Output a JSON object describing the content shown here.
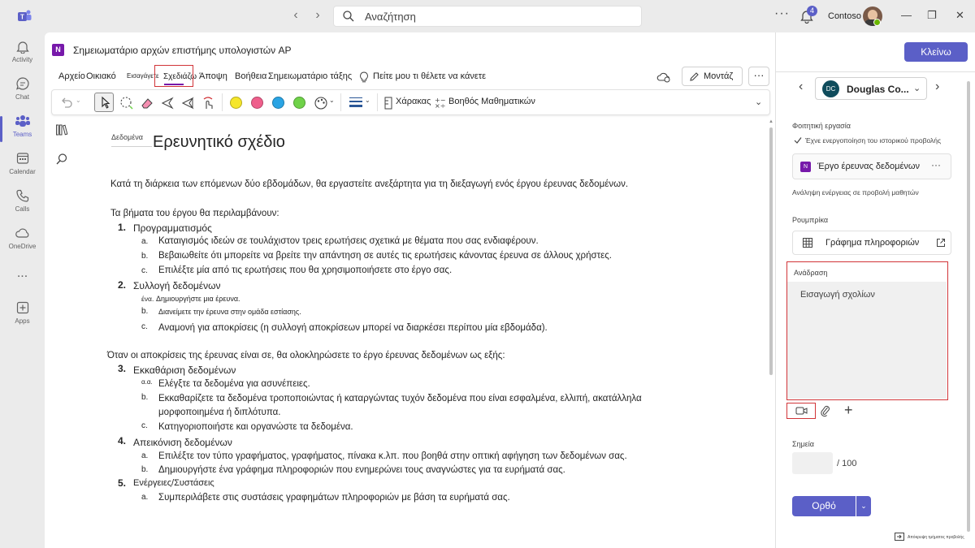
{
  "topbar": {
    "search_placeholder": "Αναζήτηση",
    "notification_count": "4",
    "org_name": "Contoso"
  },
  "rail": {
    "items": [
      {
        "label": "Activity",
        "icon": "bell-icon"
      },
      {
        "label": "Chat",
        "icon": "chat-icon"
      },
      {
        "label": "Teams",
        "icon": "teams-icon"
      },
      {
        "label": "Calendar",
        "icon": "calendar-icon"
      },
      {
        "label": "Calls",
        "icon": "phone-icon"
      },
      {
        "label": "OneDrive",
        "icon": "cloud-icon"
      },
      {
        "label": "Apps",
        "icon": "add-apps-icon"
      }
    ],
    "more": "..."
  },
  "notebook": {
    "app_icon_letter": "N",
    "title": "Σημειωματάριο αρχών επιστήμης υπολογιστών AP",
    "tabs": [
      {
        "label": "Αρχείο"
      },
      {
        "label": "Οικιακό"
      },
      {
        "label": "Εισαγάγετε"
      },
      {
        "label": "Σχεδιάζω"
      },
      {
        "label": "Άποψη"
      },
      {
        "label": "Βοήθεια"
      },
      {
        "label": "Σημειωματάριο τάξης"
      }
    ],
    "tell_me": "Πείτε μου τι θέλετε να κάνετε",
    "edit_mode_label": "Μοντάζ",
    "toolbar": {
      "pen_colors": [
        "#f5e62b",
        "#ef5f8c",
        "#2aa4e4",
        "#6fd249"
      ],
      "ruler_label": "Χάρακας",
      "math_label": "Βοηθός Μαθηματικών"
    }
  },
  "page": {
    "date_tag": "Δεδομένα",
    "title": "Ερευνητικό σχέδιο",
    "intro": "Κατά τη διάρκεια των επόμενων δύο εβδομάδων, θα εργαστείτε ανεξάρτητα για τη διεξαγωγή ενός έργου έρευνας δεδομένων.",
    "steps_intro": "Τα βήματα του έργου θα περιλαμβάνουν:",
    "mid_text": "Όταν οι αποκρίσεις της έρευνας είναι σε, θα ολοκληρώσετε το έργο έρευνας δεδομένων ως εξής:",
    "sections": [
      {
        "num": "1.",
        "title": "Προγραμματισμός",
        "items": [
          {
            "letter": "a.",
            "text": "Καταιγισμός ιδεών σε τουλάχιστον τρεις ερωτήσεις σχετικά με θέματα που σας ενδιαφέρουν."
          },
          {
            "letter": "b.",
            "text": "Βεβαιωθείτε ότι μπορείτε να βρείτε την απάντηση σε αυτές τις ερωτήσεις κάνοντας έρευνα σε άλλους χρήστες."
          },
          {
            "letter": "c.",
            "text": "Επιλέξτε μία από τις ερωτήσεις που θα χρησιμοποιήσετε στο έργο σας."
          }
        ]
      },
      {
        "num": "2.",
        "title": "Συλλογή δεδομένων",
        "items": [
          {
            "letter": "ένα.",
            "text": "Δημιουργήστε μια έρευνα."
          },
          {
            "letter": "b.",
            "text": "Διανείμετε την έρευνα στην ομάδα εστίασης."
          },
          {
            "letter": "c.",
            "text": "Αναμονή για αποκρίσεις (η συλλογή αποκρίσεων μπορεί να διαρκέσει περίπου μία εβδομάδα)."
          }
        ]
      },
      {
        "num": "3.",
        "title": "Εκκαθάριση δεδομένων",
        "items": [
          {
            "letter": "α.α.",
            "text": "Ελέγξτε τα δεδομένα για ασυνέπειες."
          },
          {
            "letter": "b.",
            "text": "Εκκαθαρίζετε τα δεδομένα τροποποιώντας ή καταργώντας τυχόν δεδομένα που είναι εσφαλμένα, ελλιπή, ακατάλληλα"
          },
          {
            "letter": "",
            "text": "μορφοποιημένα ή διπλότυπα."
          },
          {
            "letter": "c.",
            "text": "Κατηγοριοποιήστε και οργανώστε τα δεδομένα."
          }
        ]
      },
      {
        "num": "4.",
        "title": "Απεικόνιση δεδομένων",
        "items": [
          {
            "letter": "a.",
            "text": "Επιλέξτε τον τύπο γραφήματος, γραφήματος, πίνακα κ.λπ. που βοηθά στην οπτική αφήγηση των δεδομένων σας."
          },
          {
            "letter": "b.",
            "text": "Δημιουργήστε ένα γράφημα πληροφοριών που ενημερώνει τους αναγνώστες για τα ευρήματά σας."
          }
        ]
      },
      {
        "num": "5.",
        "title": "Ενέργειες/Συστάσεις",
        "items": [
          {
            "letter": "a.",
            "text": "Συμπεριλάβετε στις συστάσεις γραφημάτων πληροφοριών με βάση τα ευρήματά σας."
          }
        ]
      }
    ]
  },
  "side": {
    "close_label": "Κλείνω",
    "student_initials": "DC",
    "student_name": "Douglas Co...",
    "student_work_label": "Φοιτητική εργασία",
    "history_note": "Έχνε ενεργοποίηση του ιστορικού προβολής",
    "work_item": "Έργο έρευνας δεδομένων",
    "student_view_link": "Ανάληψη ενέργειας σε προβολή μαθητών",
    "rubric_label": "Ρουμπρίκα",
    "rubric_item": "Γράφημα πληροφοριών",
    "feedback_label": "Ανάδραση",
    "feedback_placeholder": "Εισαγωγή σχολίων",
    "points_label": "Σημεία",
    "points_max": "/ 100",
    "return_label": "Ορθό",
    "collapse_label": "Απόκρυψη τμήματος προβολής"
  }
}
